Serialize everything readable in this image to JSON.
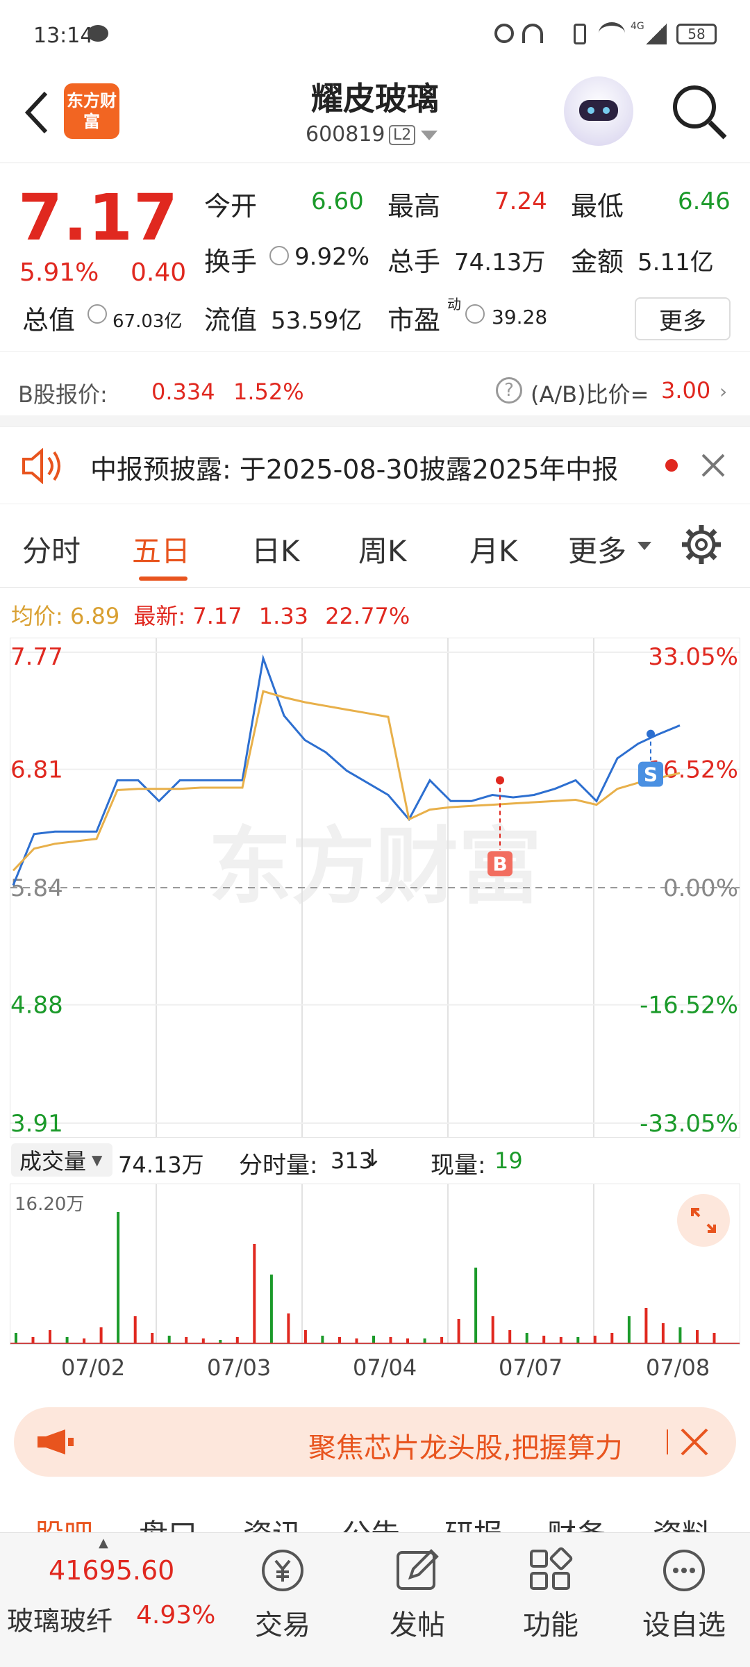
{
  "status_bar": {
    "time": "13:14",
    "network": "4G",
    "battery": "58"
  },
  "header": {
    "title": "耀皮玻璃",
    "code": "600819",
    "level": "L2",
    "logo_text": "东方财富"
  },
  "quote": {
    "price": "7.17",
    "change_pct": "5.91%",
    "change": "0.40",
    "open_label": "今开",
    "open": "6.60",
    "high_label": "最高",
    "high": "7.24",
    "low_label": "最低",
    "low": "6.46",
    "turnover_label": "换手",
    "turnover": "9.92%",
    "volume_label": "总手",
    "volume": "74.13万",
    "amount_label": "金额",
    "amount": "5.11亿",
    "mktcap_label": "总值",
    "mktcap": "67.03亿",
    "float_label": "流值",
    "float": "53.59亿",
    "pe_label": "市盈",
    "pe_sup": "动",
    "pe": "39.28",
    "more": "更多"
  },
  "bshare": {
    "label": "B股报价:",
    "price": "0.334",
    "pct": "1.52%",
    "ratio_label": "(A/B)比价=",
    "ratio": "3.00"
  },
  "notice": {
    "text": "中报预披露: 于2025-08-30披露2025年中报"
  },
  "tabs": {
    "t1": "分时",
    "t2": "五日",
    "t3": "日K",
    "t4": "周K",
    "t5": "月K",
    "t6": "更多"
  },
  "avgline": {
    "avg_label": "均价:",
    "avg": "6.89",
    "last_label": "最新:",
    "last": "7.17",
    "chg": "1.33",
    "pct": "22.77%"
  },
  "chart_data": {
    "type": "line",
    "title": "",
    "y_ticks_left": [
      "7.77",
      "6.81",
      "5.84",
      "4.88",
      "3.91"
    ],
    "y_ticks_right": [
      "33.05%",
      "16.52%",
      "0.00%",
      "-16.52%",
      "-33.05%"
    ],
    "ylim": [
      3.91,
      7.77
    ],
    "x_days": [
      "07/02",
      "07/03",
      "07/04",
      "07/07",
      "07/08"
    ],
    "series": [
      {
        "name": "",
        "values": [
          5.86,
          6.28,
          6.3,
          6.3,
          6.3,
          6.72,
          6.72,
          6.55,
          6.72,
          6.72,
          6.72,
          6.72,
          7.72,
          7.25,
          7.05,
          6.95,
          6.8,
          6.7,
          6.6,
          6.4,
          6.72,
          6.55,
          6.55,
          6.6,
          6.58,
          6.6,
          6.65,
          6.72,
          6.55,
          6.9,
          7.02,
          7.1,
          7.17
        ]
      },
      {
        "name": "",
        "values": [
          5.98,
          6.16,
          6.2,
          6.22,
          6.24,
          6.64,
          6.65,
          6.65,
          6.65,
          6.66,
          6.66,
          6.66,
          7.45,
          7.4,
          7.36,
          7.33,
          7.3,
          7.27,
          7.24,
          6.4,
          6.48,
          6.5,
          6.51,
          6.52,
          6.53,
          6.54,
          6.55,
          6.56,
          6.52,
          6.65,
          6.7,
          6.74,
          6.78
        ]
      }
    ],
    "markers": [
      {
        "label": "B",
        "price": 6.72
      },
      {
        "label": "S",
        "price": 7.1
      }
    ],
    "watermark": "东方财富"
  },
  "volume": {
    "selector": "成交量",
    "total": "74.13万",
    "tick_label": "分时量:",
    "tick": "313",
    "now_label": "现量:",
    "now": "19",
    "max": "16.20万",
    "bars": [
      0.08,
      0.05,
      0.1,
      0.05,
      0.04,
      0.12,
      0.95,
      0.2,
      0.08,
      0.06,
      0.05,
      0.04,
      0.03,
      0.05,
      0.72,
      0.5,
      0.22,
      0.1,
      0.06,
      0.05,
      0.04,
      0.06,
      0.05,
      0.04,
      0.04,
      0.05,
      0.18,
      0.55,
      0.2,
      0.1,
      0.08,
      0.06,
      0.05,
      0.05,
      0.06,
      0.08,
      0.2,
      0.26,
      0.15,
      0.12,
      0.1,
      0.08
    ]
  },
  "banner": {
    "text": "聚焦芯片龙头股,把握算力"
  },
  "bottom_tabs": {
    "b1": "股吧",
    "b2": "盘口",
    "b3": "资讯",
    "b4": "公告",
    "b5": "研报",
    "b6": "财务",
    "b7": "资料"
  },
  "bottom": {
    "index": "41695.60",
    "sector": "玻璃玻纤",
    "sector_pct": "4.93%",
    "trade": "交易",
    "post": "发帖",
    "func": "功能",
    "watch": "设自选"
  }
}
